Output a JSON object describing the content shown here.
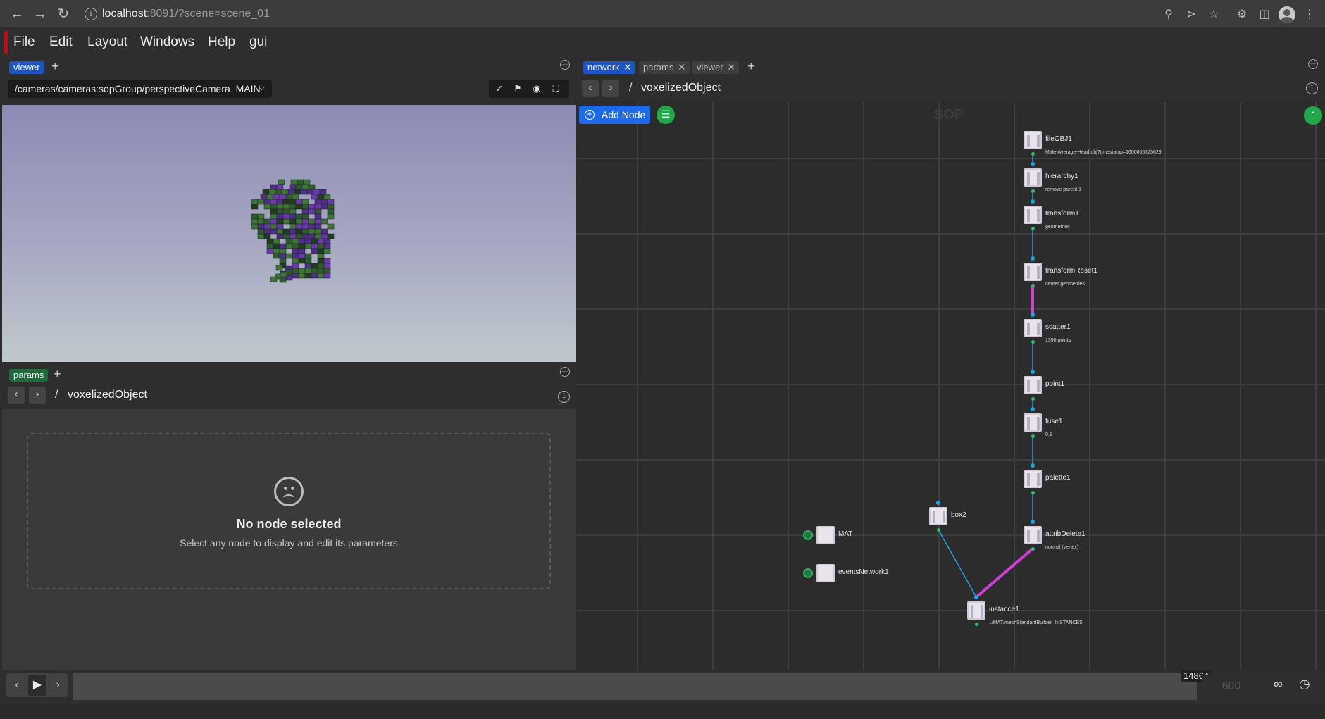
{
  "browser": {
    "url_host": "localhost",
    "url_rest": ":8091/?scene=scene_01"
  },
  "menu": {
    "items": [
      "File",
      "Edit",
      "Layout",
      "Windows",
      "Help",
      "gui"
    ]
  },
  "viewer_panel": {
    "tab": "viewer",
    "camera_path": "/cameras/cameras:sopGroup/perspectiveCamera_MAIN"
  },
  "params_panel": {
    "tab": "params",
    "path_sep": "/",
    "path": "voxelizedObject",
    "badge": "1",
    "empty_title": "No node selected",
    "empty_subtitle": "Select any node to display and edit its parameters"
  },
  "network_panel": {
    "tabs": [
      "network",
      "params",
      "viewer"
    ],
    "path_sep": "/",
    "path": "voxelizedObject",
    "badge": "1",
    "add_node_label": "Add Node",
    "context_label": "SOP",
    "nodes": [
      {
        "name": "fileOBJ1",
        "sub": "Male-Average-Head.obj?timestamp=1600005725629"
      },
      {
        "name": "hierarchy1",
        "sub": "remove parent 1"
      },
      {
        "name": "transform1",
        "sub": "geometries"
      },
      {
        "name": "transformReset1",
        "sub": "center geometries"
      },
      {
        "name": "scatter1",
        "sub": "1390 points"
      },
      {
        "name": "point1",
        "sub": ""
      },
      {
        "name": "fuse1",
        "sub": "0.1"
      },
      {
        "name": "palette1",
        "sub": ""
      },
      {
        "name": "attribDelete1",
        "sub": "normal (vertex)"
      },
      {
        "name": "box2",
        "sub": ""
      },
      {
        "name": "instance1",
        "sub": "../MAT/meshStandardBuilder_INSTANCES"
      },
      {
        "name": "MAT",
        "sub": ""
      },
      {
        "name": "eventsNetwork1",
        "sub": ""
      }
    ]
  },
  "timeline": {
    "current_frame": "14864",
    "end_frame": "600"
  },
  "colors": {
    "accent_blue": "#1f6ae8",
    "accent_green": "#21a84a",
    "connection_blue": "#1aa3e8",
    "connection_magenta": "#d23fd6",
    "menu_accent_red": "#b21414"
  }
}
